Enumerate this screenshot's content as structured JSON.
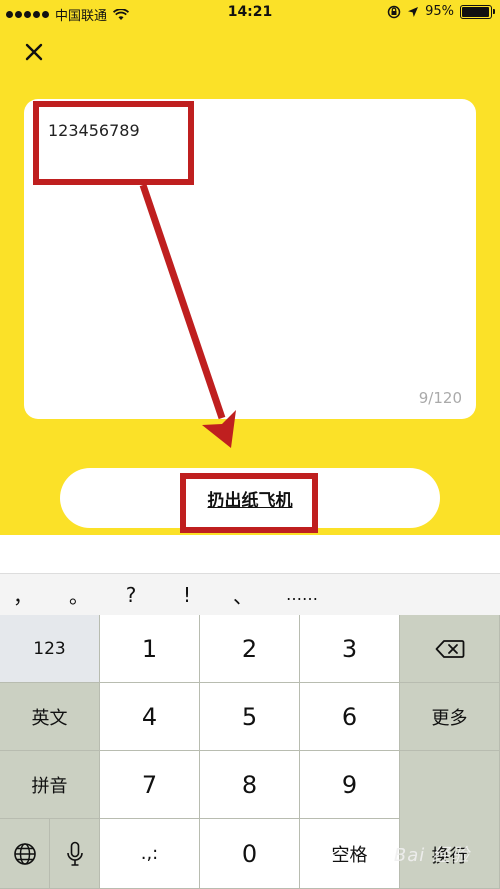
{
  "status_bar": {
    "carrier": "中国联通",
    "time": "14:21",
    "battery_percent": "95%",
    "battery_level": 0.95
  },
  "compose": {
    "text": "123456789",
    "counter": "9/120"
  },
  "action_button": {
    "label": "扔出纸飞机"
  },
  "punctuation": [
    "，",
    "。",
    "?",
    "!",
    "、",
    "……"
  ],
  "keyboard": {
    "mode_123": "123",
    "english": "英文",
    "pinyin": "拼音",
    "more": "更多",
    "return": "换行",
    "space": "空格",
    "punct_key": ".,:",
    "numbers": [
      "1",
      "2",
      "3",
      "4",
      "5",
      "6",
      "7",
      "8",
      "9",
      "0"
    ]
  },
  "watermark": "Bai 经验",
  "colors": {
    "background_yellow": "#fbe128",
    "highlight_red": "#bf1f1f"
  },
  "icons": [
    "close-icon",
    "wifi-icon",
    "location-icon",
    "rotation-lock-icon",
    "backspace-icon",
    "globe-icon",
    "microphone-icon"
  ]
}
